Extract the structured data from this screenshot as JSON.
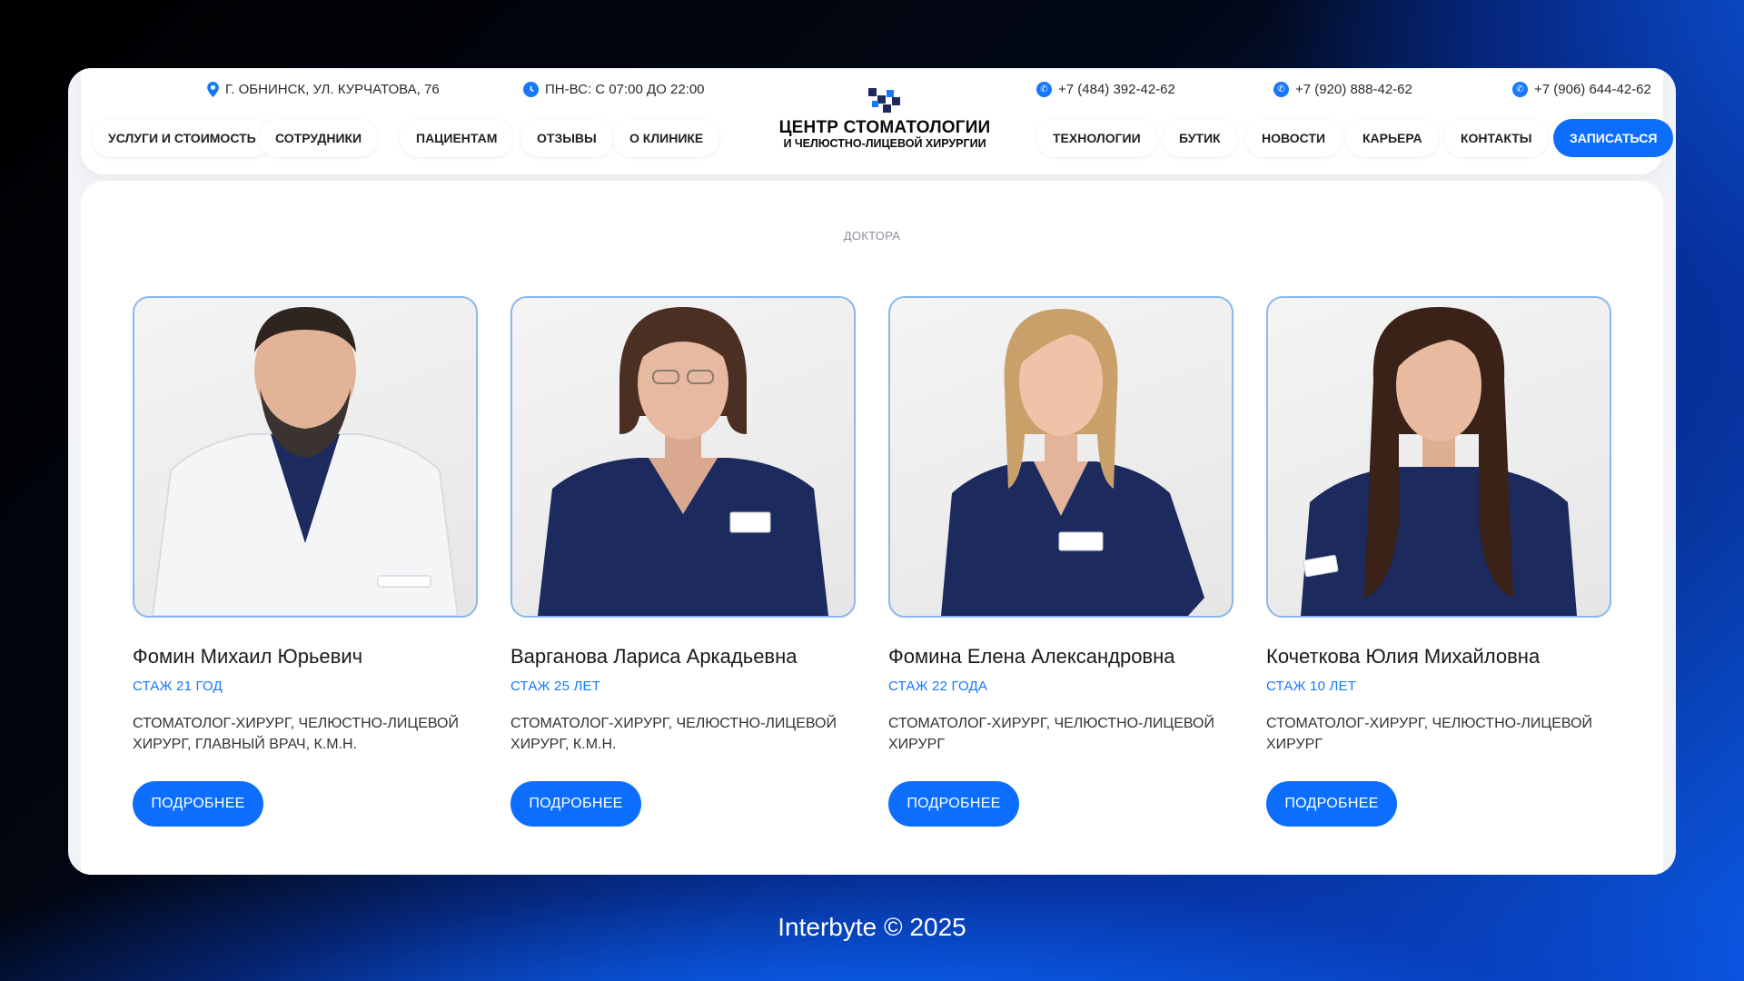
{
  "header": {
    "address": "Г. ОБНИНСК, УЛ. КУРЧАТОВА, 76",
    "hours": "ПН-ВС: С 07:00 ДО 22:00",
    "phones": [
      "+7 (484) 392-42-62",
      "+7 (920) 888-42-62",
      "+7 (906) 644-42-62"
    ],
    "logo_line1": "ЦЕНТР СТОМАТОЛОГИИ",
    "logo_line2": "И ЧЕЛЮСТНО-ЛИЦЕВОЙ ХИРУРГИИ",
    "nav_left": [
      "УСЛУГИ И СТОИМОСТЬ",
      "СОТРУДНИКИ",
      "ПАЦИЕНТАМ",
      "ОТЗЫВЫ",
      "О КЛИНИКЕ"
    ],
    "nav_right": [
      "ТЕХНОЛОГИИ",
      "БУТИК",
      "НОВОСТИ",
      "КАРЬЕРА",
      "КОНТАКТЫ"
    ],
    "cta": "ЗАПИСАТЬСЯ"
  },
  "section": {
    "label": "ДОКТОРА"
  },
  "doctors": [
    {
      "name": "Фомин Михаил Юрьевич",
      "experience": "СТАЖ 21 ГОД",
      "role": "СТОМАТОЛОГ-ХИРУРГ, ЧЕЛЮСТНО-ЛИЦЕВОЙ ХИРУРГ, ГЛАВНЫЙ ВРАЧ, К.М.Н.",
      "button": "ПОДРОБНЕЕ"
    },
    {
      "name": "Варганова Лариса Аркадьевна",
      "experience": "СТАЖ 25 ЛЕТ",
      "role": "СТОМАТОЛОГ-ХИРУРГ, ЧЕЛЮСТНО-ЛИЦЕВОЙ ХИРУРГ, К.М.Н.",
      "button": "ПОДРОБНЕЕ"
    },
    {
      "name": "Фомина Елена Александровна",
      "experience": "СТАЖ 22 ГОДА",
      "role": "СТОМАТОЛОГ-ХИРУРГ, ЧЕЛЮСТНО-ЛИЦЕВОЙ ХИРУРГ",
      "button": "ПОДРОБНЕЕ"
    },
    {
      "name": "Кочеткова Юлия Михайловна",
      "experience": "СТАЖ 10 ЛЕТ",
      "role": "СТОМАТОЛОГ-ХИРУРГ, ЧЕЛЮСТНО-ЛИЦЕВОЙ ХИРУРГ",
      "button": "ПОДРОБНЕЕ"
    }
  ],
  "footer": {
    "text": "Interbyte © 2025"
  },
  "colors": {
    "accent": "#0d6efd",
    "scrub": "#1c2a5e",
    "background_dark": "#000000",
    "background_blue": "#0b5ae8"
  }
}
